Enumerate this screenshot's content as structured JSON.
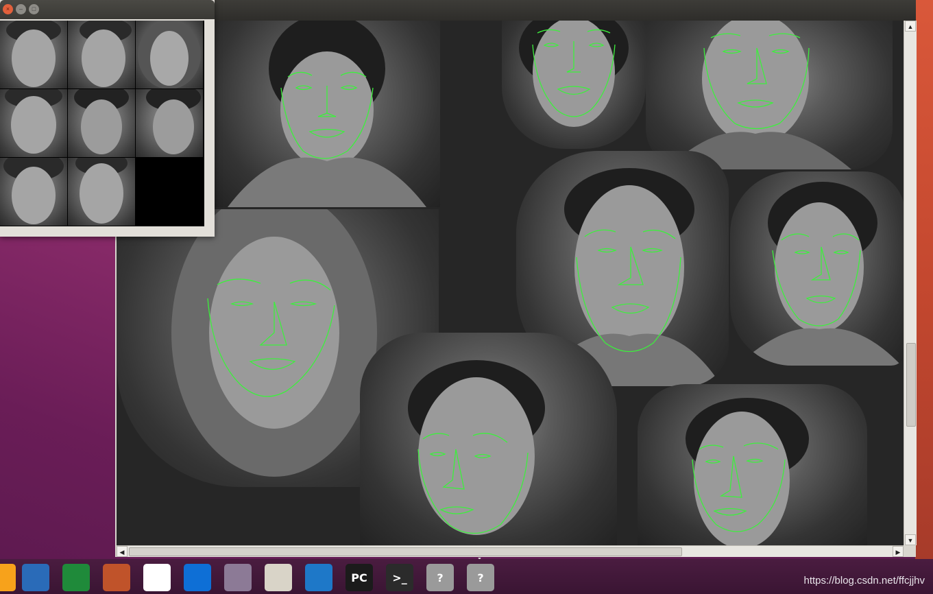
{
  "watermark": "https://blog.csdn.net/ffcjjhv",
  "thumb_window": {
    "buttons": {
      "close": "×",
      "minimize": "–",
      "maximize": "□"
    }
  },
  "main_window": {
    "scrollbar": {
      "up": "▲",
      "down": "▼",
      "left": "◀",
      "right": "▶"
    }
  },
  "taskbar": {
    "items": [
      {
        "name": "firefox-icon",
        "glyph": "",
        "color": "#f7a21b"
      },
      {
        "name": "libreoffice-writer-icon",
        "glyph": "",
        "color": "#2a6bb8"
      },
      {
        "name": "libreoffice-calc-icon",
        "glyph": "",
        "color": "#1f8a3a"
      },
      {
        "name": "libreoffice-impress-icon",
        "glyph": "",
        "color": "#c0532a"
      },
      {
        "name": "wechat-icon",
        "glyph": "",
        "color": "#ffffff"
      },
      {
        "name": "teamviewer-icon",
        "glyph": "",
        "color": "#0e6fd6"
      },
      {
        "name": "camera-app-icon",
        "glyph": "",
        "color": "#8c7a96"
      },
      {
        "name": "text-editor-icon",
        "glyph": "",
        "color": "#d9d4c8"
      },
      {
        "name": "vscode-icon",
        "glyph": "",
        "color": "#1e78c8"
      },
      {
        "name": "pycharm-icon",
        "glyph": "PC",
        "color": "#1b1b1b"
      },
      {
        "name": "terminal-icon",
        "glyph": ">_",
        "color": "#2b2b2b"
      },
      {
        "name": "unknown-app-icon",
        "glyph": "?",
        "color": "#9a9a9a"
      },
      {
        "name": "unknown-app-icon",
        "glyph": "?",
        "color": "#9a9a9a"
      }
    ]
  },
  "colors": {
    "landmark": "#3cf03c"
  }
}
